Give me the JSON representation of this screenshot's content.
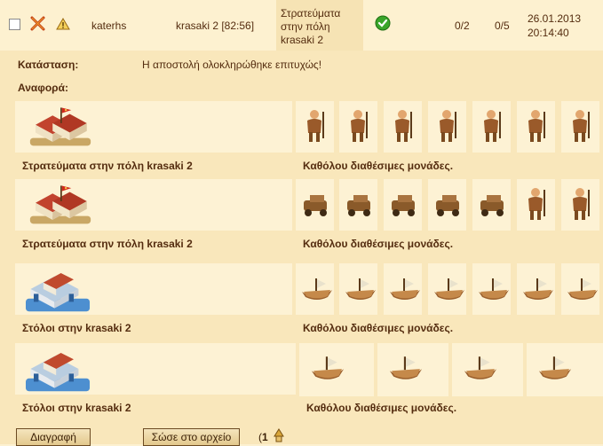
{
  "message": {
    "sender": "katerhs",
    "target": "krasaki 2 [82:56]",
    "subject": [
      "Στρατεύματα",
      "στην πόλη",
      "krasaki 2"
    ],
    "count1": "0/2",
    "count2": "0/5",
    "date": "26.01.2013",
    "time": "20:14:40",
    "icons": [
      "checkbox",
      "crossed-swords-icon",
      "warning-icon",
      "success-check-icon"
    ]
  },
  "details": {
    "status_label": "Κατάσταση:",
    "status_text": "Η αποστολή ολοκληρώθηκε επιτυχώς!",
    "report_label": "Αναφορά:"
  },
  "sections": [
    {
      "caption": "Στρατεύματα στην πόλη krasaki 2",
      "availability": "Καθόλου διαθέσιμες μονάδες.",
      "units": [
        "swordsman",
        "slinger",
        "hoplite",
        "sulphur-carabineer",
        "spearman",
        "archer",
        "mortar"
      ]
    },
    {
      "caption": "Στρατεύματα στην πόλη krasaki 2",
      "availability": "Καθόλου διαθέσιμες μονάδες.",
      "units": [
        "battering-ram",
        "catapult",
        "steam-giant",
        "gyrocopter",
        "balloon-bombardier",
        "cook",
        "doctor"
      ]
    },
    {
      "caption": "Στόλοι στην krasaki 2",
      "availability": "Καθόλου διαθέσιμες μονάδες.",
      "units": [
        "ram-ship",
        "flamethrower-ship",
        "steam-ram",
        "ballista-ship",
        "catapult-ship",
        "mortar-ship",
        "rocket-ship"
      ]
    },
    {
      "caption": "Στόλοι στην krasaki 2",
      "availability": "Καθόλου διαθέσιμες μονάδες.",
      "units": [
        "submarine",
        "paddle-speedboat",
        "balloon-carrier",
        "tender"
      ]
    }
  ],
  "buttons": {
    "delete": "Διαγραφή",
    "save": "Σώσε στο αρχείο"
  },
  "pager": {
    "open": "(",
    "page": "1"
  },
  "colors": {
    "background": "#fdf1d0",
    "panel": "#f9e7bb",
    "text": "#542c0f"
  }
}
